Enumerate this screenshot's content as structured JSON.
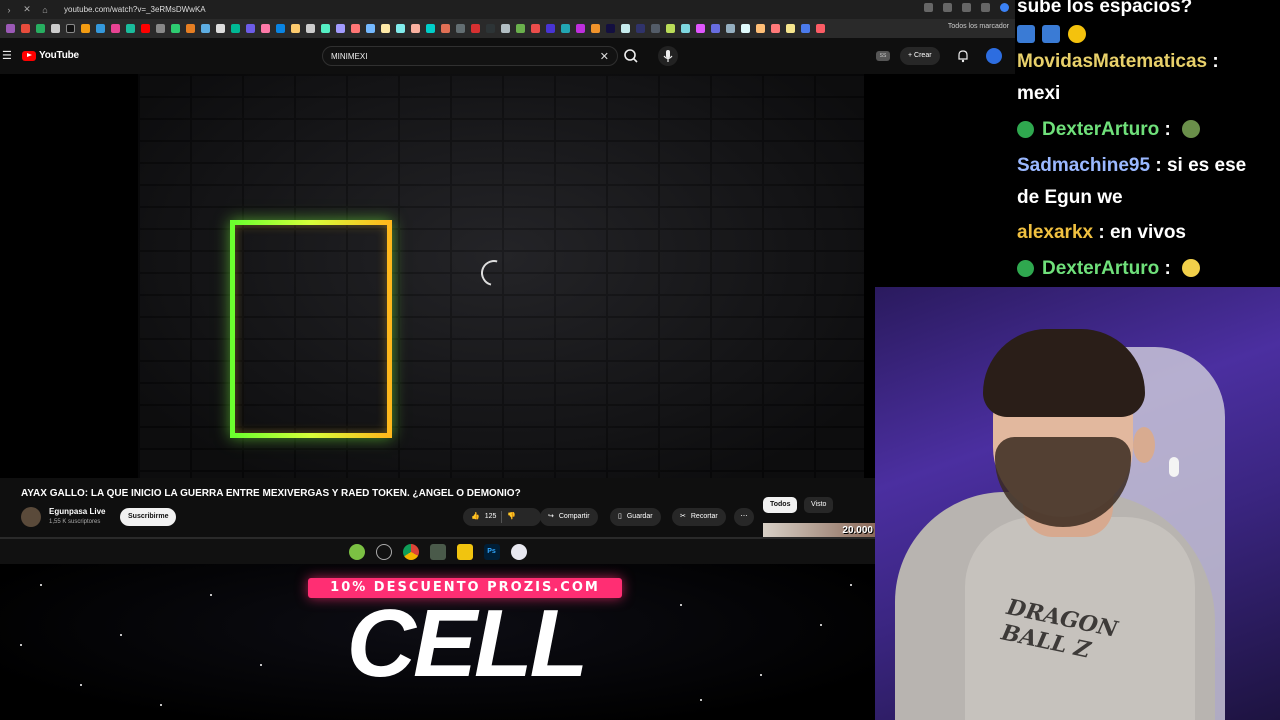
{
  "browser": {
    "url": "youtube.com/watch?v=_3eRMsDWwKA",
    "bookmarks_folder": "Todos los marcador"
  },
  "youtube": {
    "logo_text": "YouTube",
    "search_query": "MINIMEXI",
    "create_label": "Crear",
    "avatar_initials": "SS"
  },
  "video": {
    "title": "AYAX GALLO: LA QUE INICIO LA GUERRA ENTRE MEXIVERGAS Y RAED TOKEN. ¿ANGEL O DEMONIO?",
    "channel_name": "Egunpasa Live",
    "subscribers": "1,55 K suscriptores",
    "subscribe_label": "Suscribirme",
    "likes": "125",
    "share_label": "Compartir",
    "save_label": "Guardar",
    "clip_label": "Recortar"
  },
  "sidebar_chips": {
    "all": "Todos",
    "seen": "Visto",
    "thumb_text": "20.000"
  },
  "promo": {
    "banner": "10% DESCUENTO PROZIS.COM",
    "big": "CELL"
  },
  "chat": {
    "messages": [
      {
        "user": "",
        "text": "sube los espacios?",
        "user_color": "#ffffff"
      },
      {
        "user": "MovidasMatematicas",
        "text": ": mexi",
        "user_color": "#e8d06a"
      },
      {
        "user": "DexterArturo",
        "text": ":",
        "user_color": "#6fe07a"
      },
      {
        "user": "Sadmachine95",
        "text": ": si es ese de Egun we",
        "user_color": "#9ab8ff"
      },
      {
        "user": "alexarkx",
        "text": ": en vivos",
        "user_color": "#f0c040"
      },
      {
        "user": "DexterArturo",
        "text": ":",
        "user_color": "#6fe07a"
      }
    ]
  },
  "webcam": {
    "shirt_print": "DRAGON BALL Z"
  }
}
